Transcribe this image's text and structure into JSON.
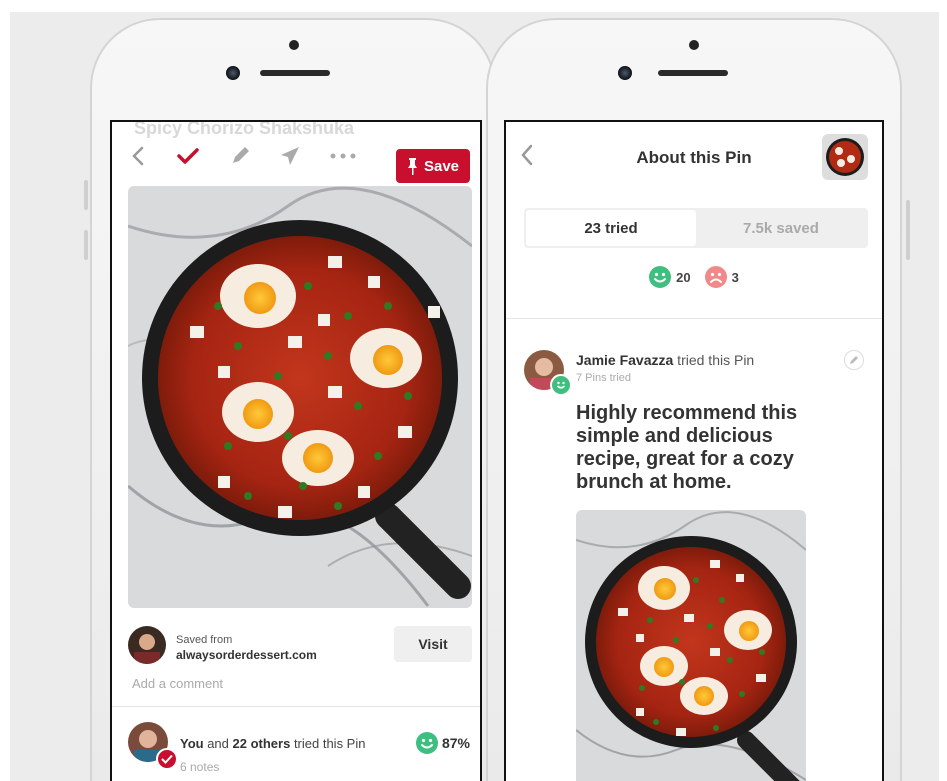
{
  "left_screen": {
    "ghost_title": "Spicy Chorizo Shakshuka",
    "save_label": "Save",
    "saved_from_label": "Saved from",
    "source_domain": "alwaysorderdessert.com",
    "visit_label": "Visit",
    "comment_placeholder": "Add a comment",
    "tried_you": "You",
    "tried_and": " and ",
    "tried_others": "22 others",
    "tried_suffix": " tried this Pin",
    "notes": "6 notes",
    "positive_percent": "87%"
  },
  "right_screen": {
    "title": "About this Pin",
    "tab_tried": "23 tried",
    "tab_saved": "7.5k saved",
    "happy_count": "20",
    "sad_count": "3",
    "user_name": "Jamie Favazza",
    "user_action": " tried this Pin",
    "pins_tried": "7 Pins tried",
    "review_text": "Highly recommend this simple and delicious recipe, great for a cozy brunch at home."
  },
  "colors": {
    "brand_red": "#c8102e",
    "happy_green": "#3fbf7f",
    "sad_red": "#f08a8a"
  },
  "icons": [
    "back-chevron-icon",
    "checkmark-icon",
    "pencil-icon",
    "send-icon",
    "more-icon",
    "pushpin-icon",
    "happy-face-icon",
    "sad-face-icon",
    "edit-icon"
  ]
}
